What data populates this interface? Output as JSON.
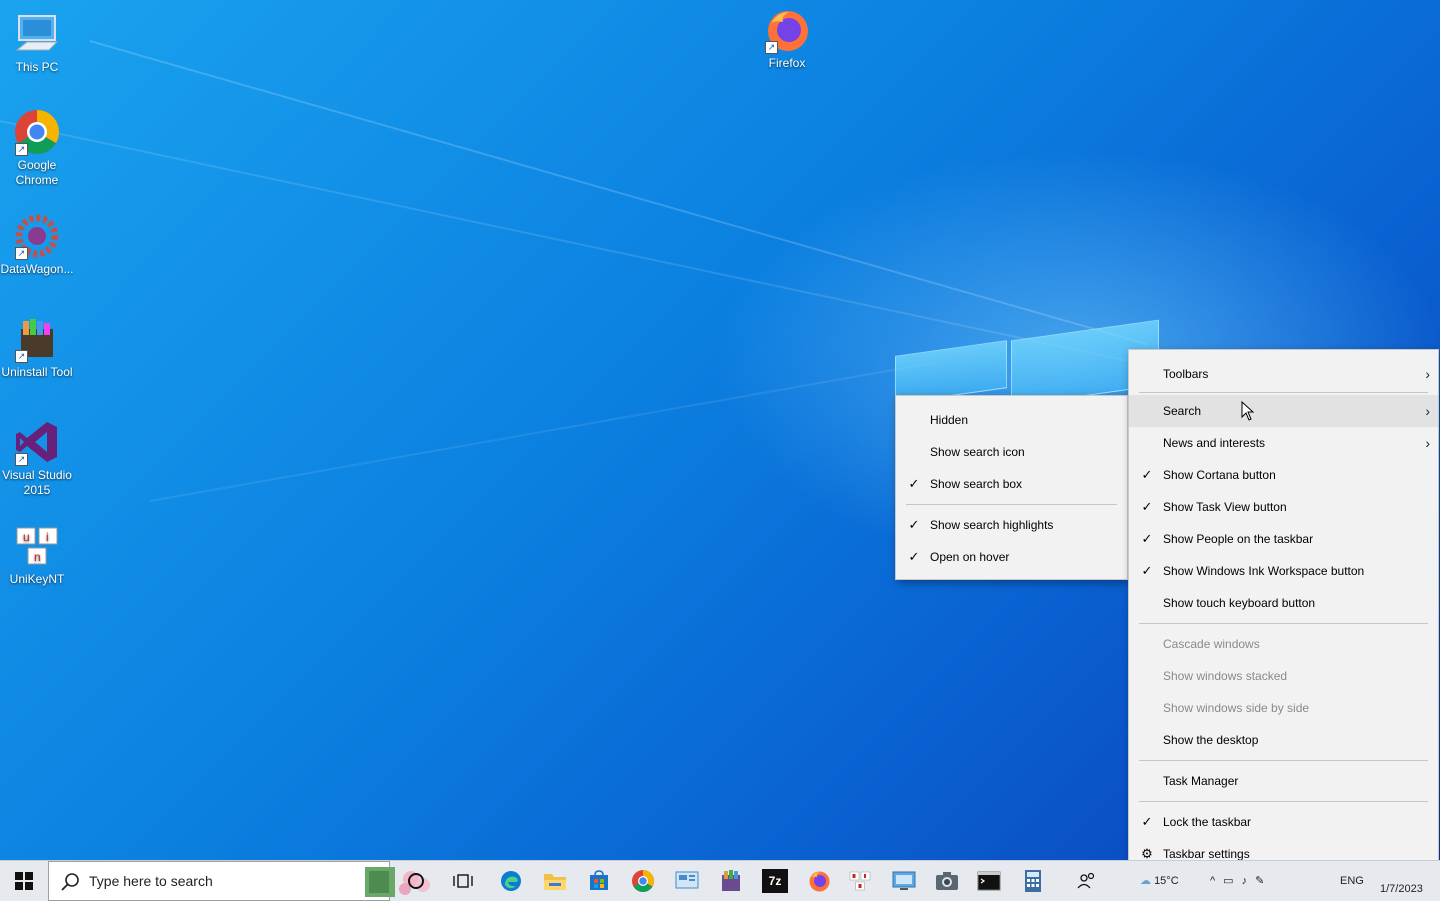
{
  "desktop": {
    "icons": [
      {
        "label": "This PC",
        "icon": "computer-icon"
      },
      {
        "label": "Google Chrome",
        "icon": "chrome-icon"
      },
      {
        "label": "DataWagon...",
        "icon": "gear-wheel-icon"
      },
      {
        "label": "Uninstall Tool",
        "icon": "uninstall-tool-icon"
      },
      {
        "label": "Visual Studio 2015",
        "icon": "visual-studio-icon"
      },
      {
        "label": "UniKeyNT",
        "icon": "unikey-icon"
      },
      {
        "label": "Firefox",
        "icon": "firefox-icon"
      }
    ]
  },
  "context_menu": {
    "items": [
      {
        "label": "Toolbars",
        "checked": false,
        "submenu": true
      },
      {
        "label": "Search",
        "checked": false,
        "submenu": true,
        "highlighted": true
      },
      {
        "label": "News and interests",
        "checked": false,
        "submenu": true
      },
      {
        "label": "Show Cortana button",
        "checked": true
      },
      {
        "label": "Show Task View button",
        "checked": true
      },
      {
        "label": "Show People on the taskbar",
        "checked": true
      },
      {
        "label": "Show Windows Ink Workspace button",
        "checked": true
      },
      {
        "label": "Show touch keyboard button",
        "checked": false
      },
      {
        "label": "Cascade windows",
        "disabled": true
      },
      {
        "label": "Show windows stacked",
        "disabled": true
      },
      {
        "label": "Show windows side by side",
        "disabled": true
      },
      {
        "label": "Show the desktop",
        "disabled": false
      },
      {
        "label": "Task Manager"
      },
      {
        "label": "Lock the taskbar",
        "checked": true
      },
      {
        "label": "Taskbar settings",
        "icon": "gear-icon"
      }
    ],
    "check_glyph": "✓",
    "arrow_glyph": "›"
  },
  "search_submenu": {
    "items": [
      {
        "label": "Hidden",
        "checked": false
      },
      {
        "label": "Show search icon",
        "checked": false
      },
      {
        "label": "Show search box",
        "checked": true
      },
      {
        "label": "Show search highlights",
        "checked": true
      },
      {
        "label": "Open on hover",
        "checked": true
      }
    ]
  },
  "taskbar": {
    "search_placeholder": "Type here to search",
    "pinned": [
      "cortana-icon",
      "task-view-icon",
      "edge-icon",
      "file-explorer-icon",
      "store-icon",
      "chrome-icon",
      "control-panel-icon",
      "winrar-icon",
      "7zip-icon",
      "firefox-icon",
      "unikey-icon",
      "remote-desktop-icon",
      "camera-icon",
      "terminal-icon",
      "calculator-icon",
      "people-icon"
    ],
    "sevenzip_label": "7z",
    "tray": {
      "temperature": "15°C",
      "language": "ENG",
      "date": "1/7/2023"
    }
  },
  "colors": {
    "desktop_accent": "#0b7fe0",
    "menu_bg": "#f2f2f2",
    "menu_hover": "#e2e2e2",
    "taskbar_bg": "#e6e9ee"
  }
}
